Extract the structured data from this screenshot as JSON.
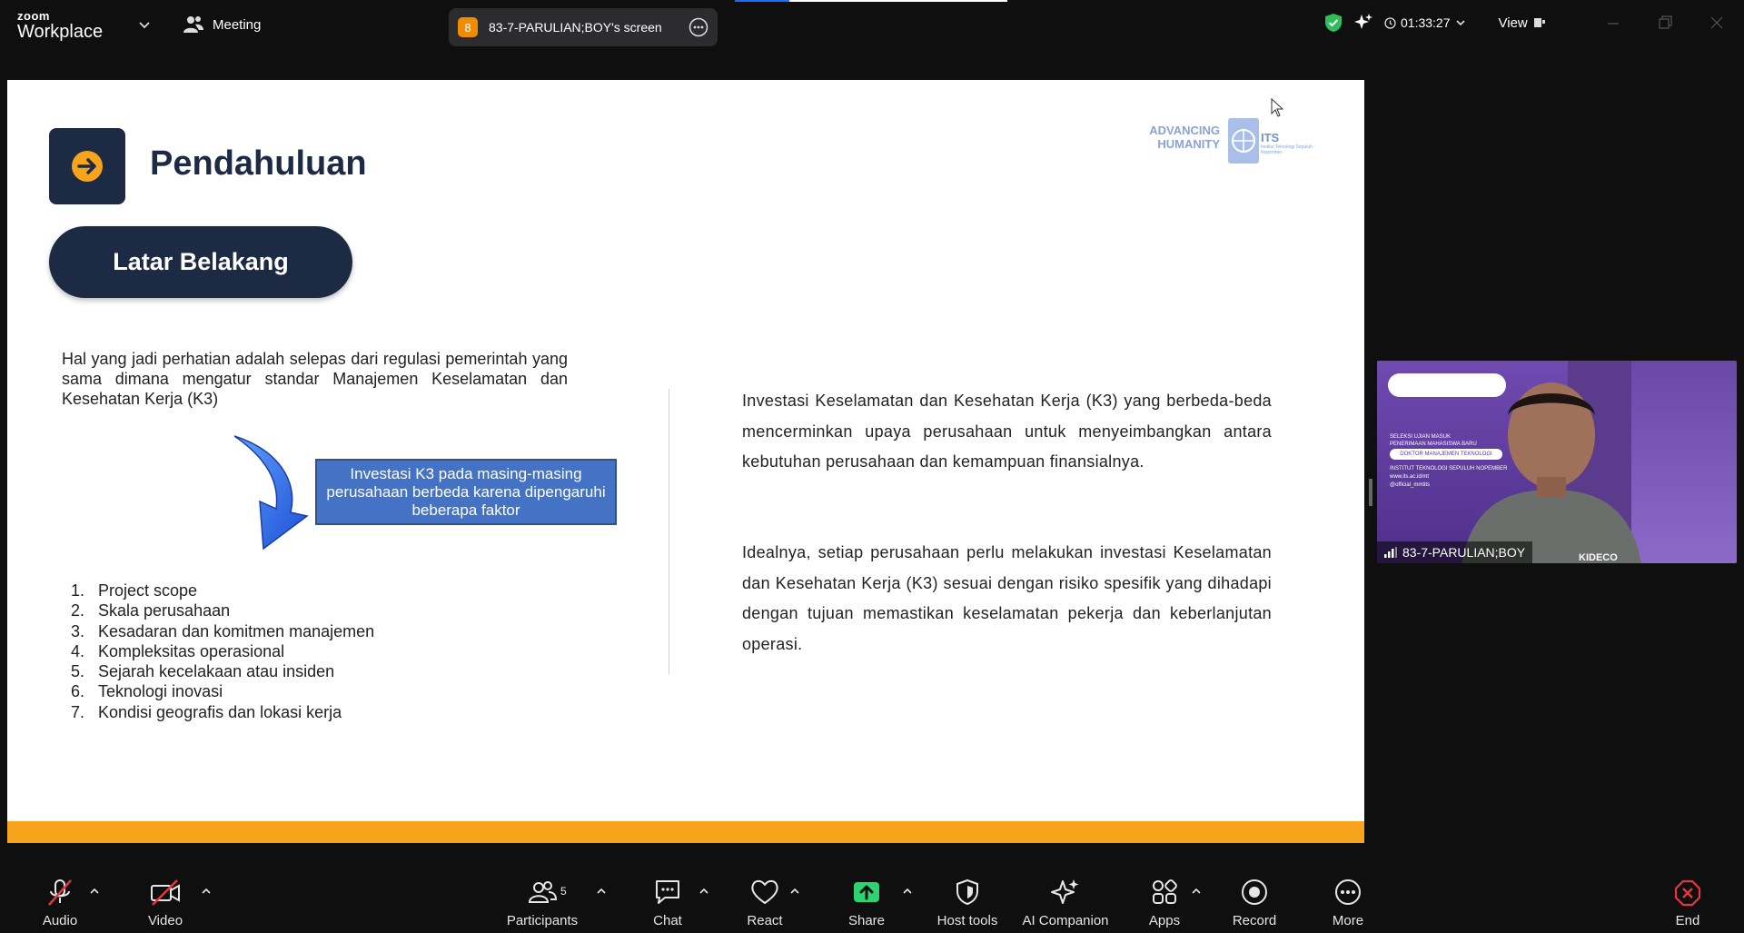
{
  "app": {
    "logo_top": "zoom",
    "logo_bottom": "Workplace",
    "meeting_label": "Meeting",
    "share_badge": "8",
    "share_label": "83-7-PARULIAN;BOY's screen",
    "timer": "01:33:27",
    "view_label": "View"
  },
  "slide": {
    "title": "Pendahuluan",
    "section": "Latar Belakang",
    "logo_advancing": "ADVANCING",
    "logo_humanity": "HUMANITY",
    "logo_its": "ITS",
    "logo_its_sub": "Institut Teknologi Sepuluh Nopember",
    "intro": "Hal yang jadi perhatian adalah selepas dari regulasi pemerintah yang sama dimana mengatur standar Manajemen Keselamatan dan Kesehatan Kerja (K3)",
    "callout": "Investasi K3 pada masing-masing perusahaan berbeda karena dipengaruhi beberapa faktor",
    "factors": [
      {
        "n": "1.",
        "text": "Project scope"
      },
      {
        "n": "2.",
        "text": "Skala perusahaan"
      },
      {
        "n": "3.",
        "text": "Kesadaran dan komitmen manajemen"
      },
      {
        "n": "4.",
        "text": "Kompleksitas operasional"
      },
      {
        "n": "5.",
        "text": "Sejarah kecelakaan atau insiden"
      },
      {
        "n": "6.",
        "text": "Teknologi inovasi"
      },
      {
        "n": "7.",
        "text": "Kondisi geografis dan lokasi kerja"
      }
    ],
    "para1": "Investasi Keselamatan dan Kesehatan Kerja (K3) yang berbeda-beda mencerminkan upaya perusahaan untuk menyeimbangkan antara kebutuhan perusahaan dan kemampuan finansialnya.",
    "para2": "Idealnya, setiap perusahaan perlu melakukan investasi Keselamatan dan Kesehatan Kerja (K3) sesuai dengan risiko spesifik yang dihadapi dengan tujuan memastikan keselamatan pekerja dan keberlanjutan operasi.",
    "colors": {
      "navy": "#1d2a44",
      "accent": "#f7a31b",
      "callout": "#4472c4"
    }
  },
  "video": {
    "participant_name": "83-7-PARULIAN;BOY",
    "banner_lines": [
      "SELEKSI UJIAN MASUK",
      "PENERIMAAN MAHASISWA BARU",
      "DOKTOR MANAJEMEN TEKNOLOGI",
      "INSTITUT TEKNOLOGI SEPULUH NOPEMBER",
      "www.its.ac.id/mt",
      "@official_mmtits"
    ],
    "shirt_logo": "KIDECO"
  },
  "toolbar": {
    "audio": "Audio",
    "video": "Video",
    "participants": "Participants",
    "participants_count": "5",
    "chat": "Chat",
    "react": "React",
    "share": "Share",
    "host_tools": "Host tools",
    "ai_companion": "AI Companion",
    "apps": "Apps",
    "record": "Record",
    "more": "More",
    "end": "End"
  }
}
